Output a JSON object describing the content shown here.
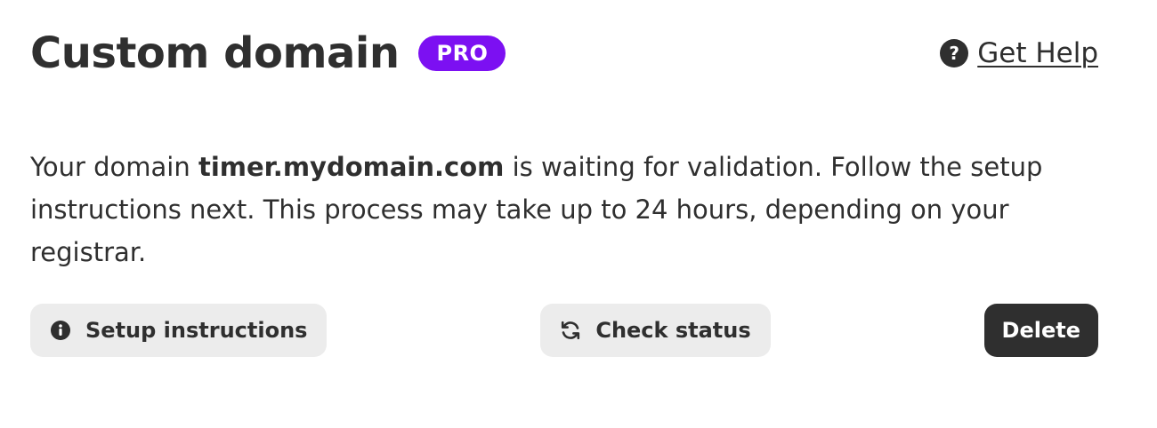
{
  "header": {
    "title": "Custom domain",
    "badge": "PRO",
    "help_label": "Get Help",
    "help_icon": "question-circle-icon"
  },
  "message": {
    "prefix": "Your domain ",
    "domain": "timer.mydomain.com",
    "suffix": " is waiting for validation. Follow the setup instructions next. This process may take up to 24 hours, depending on your registrar."
  },
  "actions": {
    "setup_label": "Setup instructions",
    "setup_icon": "info-circle-icon",
    "check_label": "Check status",
    "check_icon": "refresh-icon",
    "delete_label": "Delete"
  },
  "colors": {
    "badge_bg": "#7c10f2",
    "text": "#2f2f2f",
    "button_light_bg": "#ececec",
    "button_dark_bg": "#2f2f2f"
  }
}
